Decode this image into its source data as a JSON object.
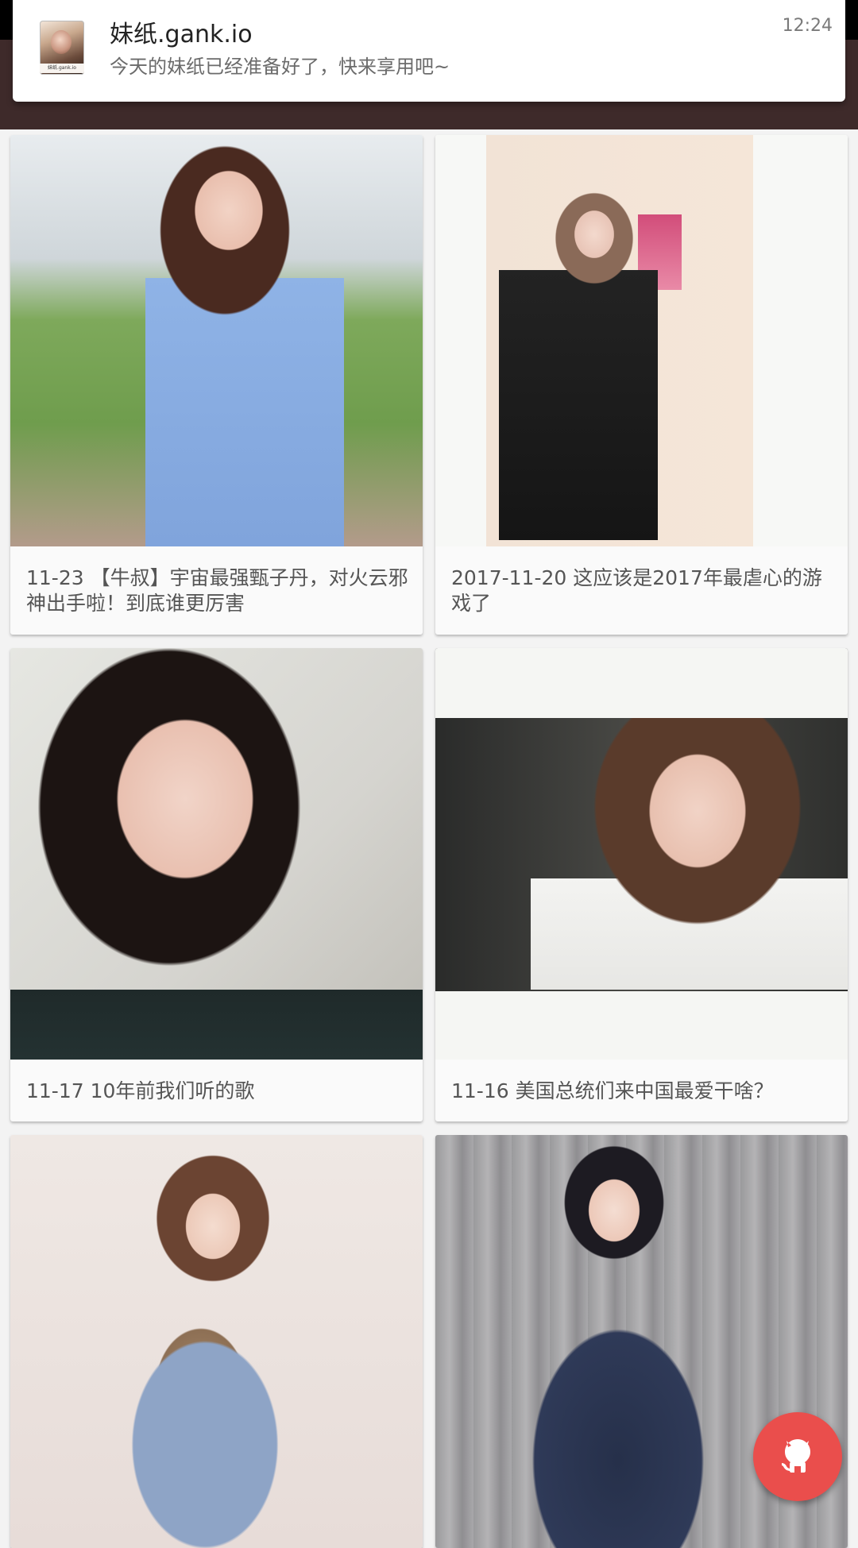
{
  "colors": {
    "appbar": "#3e2a2a",
    "fab": "#ea4e4c",
    "card_bg": "#fafafa",
    "caption_text": "#555555"
  },
  "notification": {
    "app_icon": "gank-app-icon",
    "app_icon_caption": "妹纸.gank.io",
    "title": "妹纸.gank.io",
    "text": "今天的妹纸已经准备好了，快来享用吧~",
    "time": "12:24"
  },
  "feed": {
    "cards": [
      {
        "caption": "11-23 【牛叔】宇宙最强甄子丹，对火云邪神出手啦！到底谁更厉害"
      },
      {
        "caption": "2017-11-20 这应该是2017年最虐心的游戏了"
      },
      {
        "caption": "11-17 10年前我们听的歌"
      },
      {
        "caption": "11-16 美国总统们来中国最爱干啥？"
      },
      {
        "caption": ""
      },
      {
        "caption": ""
      }
    ]
  },
  "fab": {
    "icon": "github-octocat-icon"
  }
}
